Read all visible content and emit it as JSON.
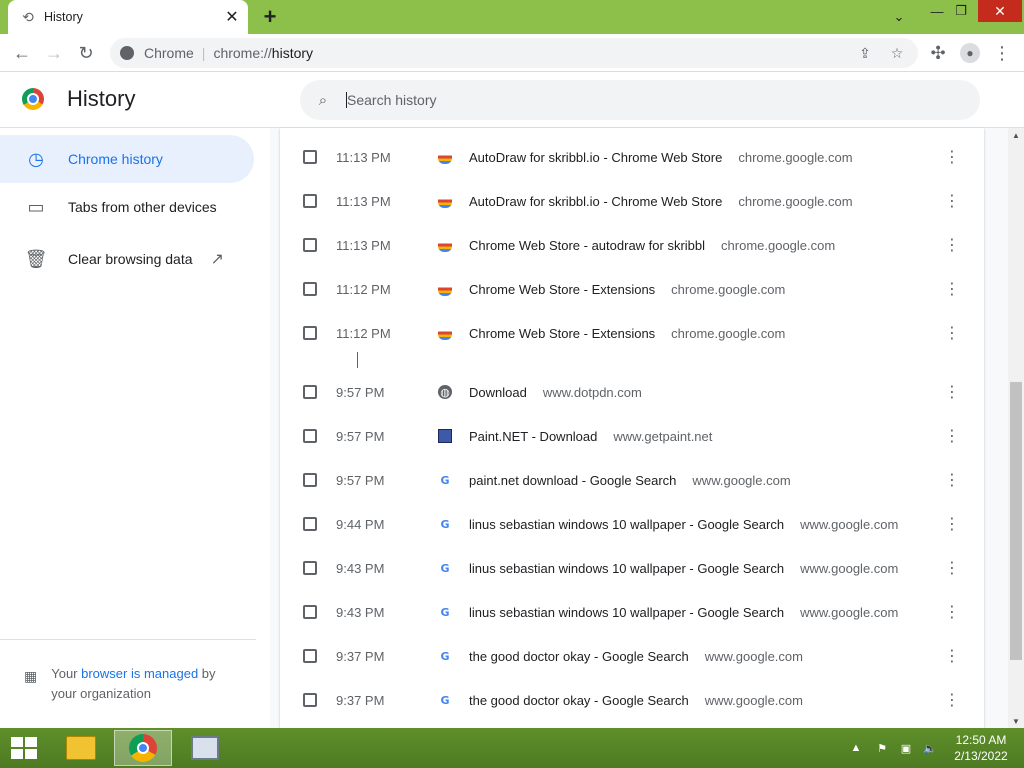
{
  "tab": {
    "title": "History",
    "close": "✕"
  },
  "window": {
    "new_tab": "+",
    "menu_chevron": "⌄",
    "minimize": "—",
    "restore": "❐",
    "close": "✕"
  },
  "toolbar": {
    "origin": "Chrome",
    "url_prefix": "chrome://",
    "url_path": "history"
  },
  "header": {
    "title": "History",
    "search_placeholder": "Search history"
  },
  "sidebar": {
    "items": [
      {
        "label": "Chrome history",
        "icon": "clock-icon",
        "active": true
      },
      {
        "label": "Tabs from other devices",
        "icon": "devices-icon",
        "active": false
      },
      {
        "label": "Clear browsing data",
        "icon": "trash-icon",
        "active": false
      }
    ],
    "managed_prefix": "Your ",
    "managed_link": "browser is managed",
    "managed_suffix": " by your organization"
  },
  "history": [
    {
      "time": "11:13 PM",
      "favicon": "webstore",
      "title": "AutoDraw for skribbl.io - Chrome Web Store",
      "domain": "chrome.google.com"
    },
    {
      "time": "11:13 PM",
      "favicon": "webstore",
      "title": "AutoDraw for skribbl.io - Chrome Web Store",
      "domain": "chrome.google.com"
    },
    {
      "time": "11:13 PM",
      "favicon": "webstore",
      "title": "Chrome Web Store - autodraw for skribbl",
      "domain": "chrome.google.com"
    },
    {
      "time": "11:12 PM",
      "favicon": "webstore",
      "title": "Chrome Web Store - Extensions",
      "domain": "chrome.google.com"
    },
    {
      "time": "11:12 PM",
      "favicon": "webstore",
      "title": "Chrome Web Store - Extensions",
      "domain": "chrome.google.com"
    },
    {
      "time": "9:57 PM",
      "favicon": "globe",
      "title": "Download",
      "domain": "www.dotpdn.com"
    },
    {
      "time": "9:57 PM",
      "favicon": "paintnet",
      "title": "Paint.NET - Download",
      "domain": "www.getpaint.net"
    },
    {
      "time": "9:57 PM",
      "favicon": "google",
      "title": "paint.net download - Google Search",
      "domain": "www.google.com"
    },
    {
      "time": "9:44 PM",
      "favicon": "google",
      "title": "linus sebastian windows 10 wallpaper - Google Search",
      "domain": "www.google.com"
    },
    {
      "time": "9:43 PM",
      "favicon": "google",
      "title": "linus sebastian windows 10 wallpaper - Google Search",
      "domain": "www.google.com"
    },
    {
      "time": "9:43 PM",
      "favicon": "google",
      "title": "linus sebastian windows 10 wallpaper - Google Search",
      "domain": "www.google.com"
    },
    {
      "time": "9:37 PM",
      "favicon": "google",
      "title": "the good doctor okay - Google Search",
      "domain": "www.google.com"
    },
    {
      "time": "9:37 PM",
      "favicon": "google",
      "title": "the good doctor okay - Google Search",
      "domain": "www.google.com"
    }
  ],
  "taskbar": {
    "apps": [
      "file-explorer",
      "chrome",
      "task-manager"
    ],
    "time": "12:50 AM",
    "date": "2/13/2022"
  },
  "colors": {
    "accent": "#1a73e8",
    "active_bg": "#e8f0fe",
    "titlebar": "#8dc04a",
    "close_red": "#c42b1c"
  }
}
